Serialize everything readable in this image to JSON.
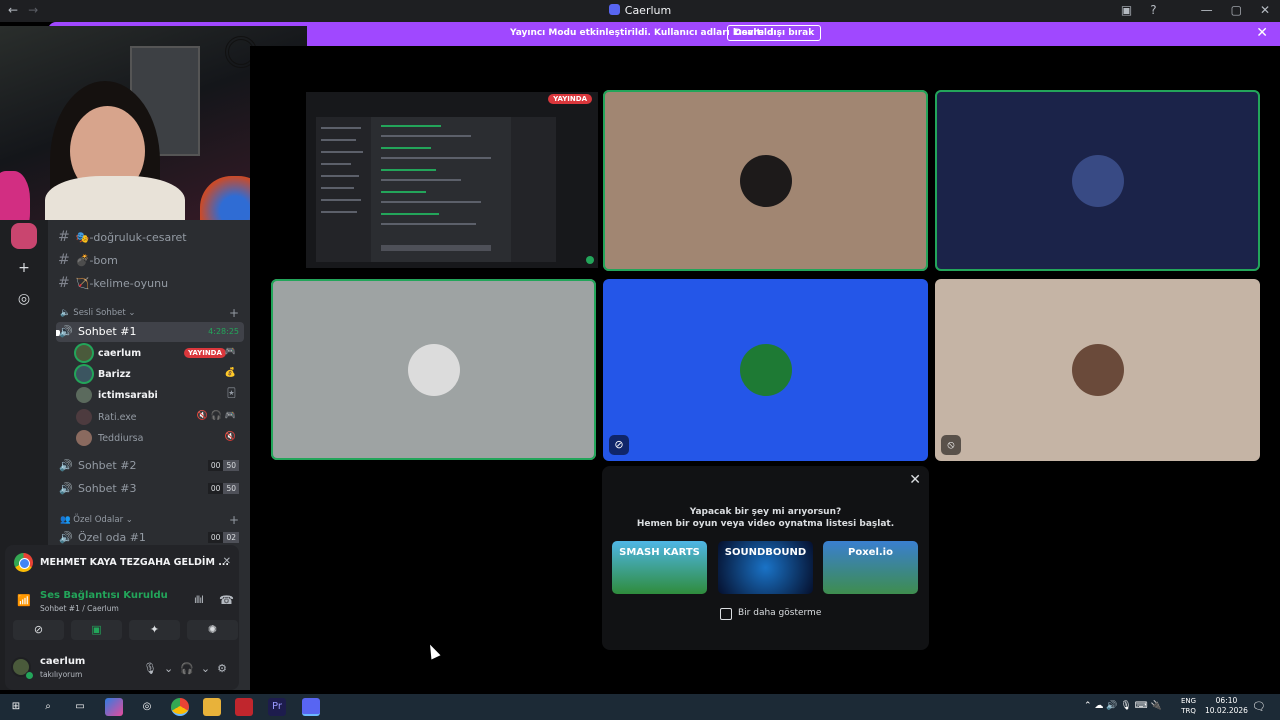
{
  "titlebar": {
    "title": "Caerlum",
    "back": "←",
    "forward": "→",
    "inbox_icon": "inbox-icon",
    "help": "?",
    "minimize": "—",
    "maximize": "▢",
    "close": "✕"
  },
  "banner": {
    "message": "Yayıncı Modu etkinleştirildi. Kullanıcı adları kısaltıldı.",
    "button": "Devre dışı bırak",
    "close": "✕",
    "color": "#a048ff"
  },
  "rail": {
    "add_icon": "plus-icon",
    "add_glyph": "+",
    "explore_icon": "compass-icon",
    "explore_glyph": "◎"
  },
  "sidebar": {
    "text_channels": [
      {
        "hash": "#",
        "emoji": "🎭",
        "name": "-doğruluk-cesaret"
      },
      {
        "hash": "#",
        "emoji": "💣",
        "name": "-bom"
      },
      {
        "hash": "#",
        "emoji": "🏹",
        "name": "-kelime-oyunu"
      }
    ],
    "voice_category": "Sesli Sohbet",
    "plus": "+",
    "voice_channels": [
      {
        "name": "Sohbet #1",
        "time": "4:28:25",
        "active": true
      },
      {
        "name": "Sohbet #2",
        "count_a": "00",
        "count_b": "50"
      },
      {
        "name": "Sohbet #3",
        "count_a": "00",
        "count_b": "50"
      }
    ],
    "members": [
      {
        "name": "caerlum",
        "badge": "YAYINDA",
        "tail": "🎮",
        "color": "#4a5a3b",
        "speaking": true
      },
      {
        "name": "Barizz",
        "tail": "💰",
        "color": "#3b5560",
        "speaking": true
      },
      {
        "name": "ictimsarabi",
        "tail": "🃏",
        "color": "#5b6a5d",
        "speaking": false
      },
      {
        "name": "Rati.exe",
        "tail": "🔇 🎧 🎮",
        "color": "#4d3b3f",
        "speaking": false,
        "muted": true
      },
      {
        "name": "Teddiursa",
        "tail": "🔇",
        "color": "#8a6a5f",
        "speaking": false,
        "muted": true
      }
    ],
    "private_category": "Özel Odalar",
    "private_rooms": [
      {
        "name": "Özel oda #1",
        "count_a": "00",
        "count_b": "02"
      }
    ],
    "speaker_glyph": "🔊"
  },
  "activity": {
    "title": "MEHMET KAYA TEZGAHA GELDİM ...",
    "close": "✕"
  },
  "voice_panel": {
    "status": "Ses Bağlantısı Kuruldu",
    "channel": "Sohbet #1 / Caerlum",
    "signal_glyph": "📶",
    "wave_glyph": "ıllıl",
    "hangup_glyph": "☎",
    "buttons": [
      {
        "icon": "camera-off-icon",
        "glyph": "⊘"
      },
      {
        "icon": "screen-share-icon",
        "glyph": "▣"
      },
      {
        "icon": "activities-icon",
        "glyph": "✦"
      },
      {
        "icon": "soundboard-icon",
        "glyph": "✺"
      }
    ],
    "user": {
      "name": "caerlum",
      "status": "takılıyorum",
      "mic_glyph": "🎙",
      "headset_glyph": "🎧",
      "chevron": "⌄",
      "settings_glyph": "⚙"
    }
  },
  "stage": {
    "live_badge": "YAYINDA",
    "tiles": [
      {
        "name": "tile-1",
        "bg": "#a18672",
        "avatar_color": "#1d1a1a",
        "speaking": true
      },
      {
        "name": "tile-2",
        "bg": "#1b2349",
        "avatar_color": "#384a84",
        "speaking": false
      },
      {
        "name": "tile-3",
        "bg": "#9ea3a3",
        "avatar_color": "#dcdcdc",
        "speaking": true
      },
      {
        "name": "tile-4",
        "bg": "#2456e8",
        "avatar_color": "#1e7a34",
        "speaking": false,
        "muted_icon": "camera-off-icon"
      },
      {
        "name": "tile-5",
        "bg": "#c5b4a5",
        "avatar_color": "#6a4a3a",
        "speaking": false,
        "muted_icon": "mic-off-icon"
      }
    ]
  },
  "promo": {
    "line1": "Yapacak bir şey mi arıyorsun?",
    "line2": "Hemen bir oyun veya video oynatma listesi başlat.",
    "close": "✕",
    "games": [
      {
        "name": "SMASH KARTS",
        "bg": "#3aa6d8"
      },
      {
        "name": "SOUNDBOUND",
        "bg": "#0a2a5c"
      },
      {
        "name": "Poxel.io",
        "bg": "#3e8d4e"
      }
    ],
    "dont_show": "Bir daha gösterme"
  },
  "taskbar": {
    "lang_top": "ENG",
    "lang_bottom": "TRQ",
    "time": "06:10",
    "date": "10.02.2026",
    "tray": "⌃ ☁ 🔊 🎙 ⌨ 🔌",
    "notif": "🗨",
    "apps": [
      "start-icon",
      "search-icon",
      "taskview-icon",
      "copilot-icon",
      "app-icon",
      "chrome-icon",
      "explorer-icon",
      "video-icon",
      "premiere-icon",
      "discord-icon"
    ]
  }
}
